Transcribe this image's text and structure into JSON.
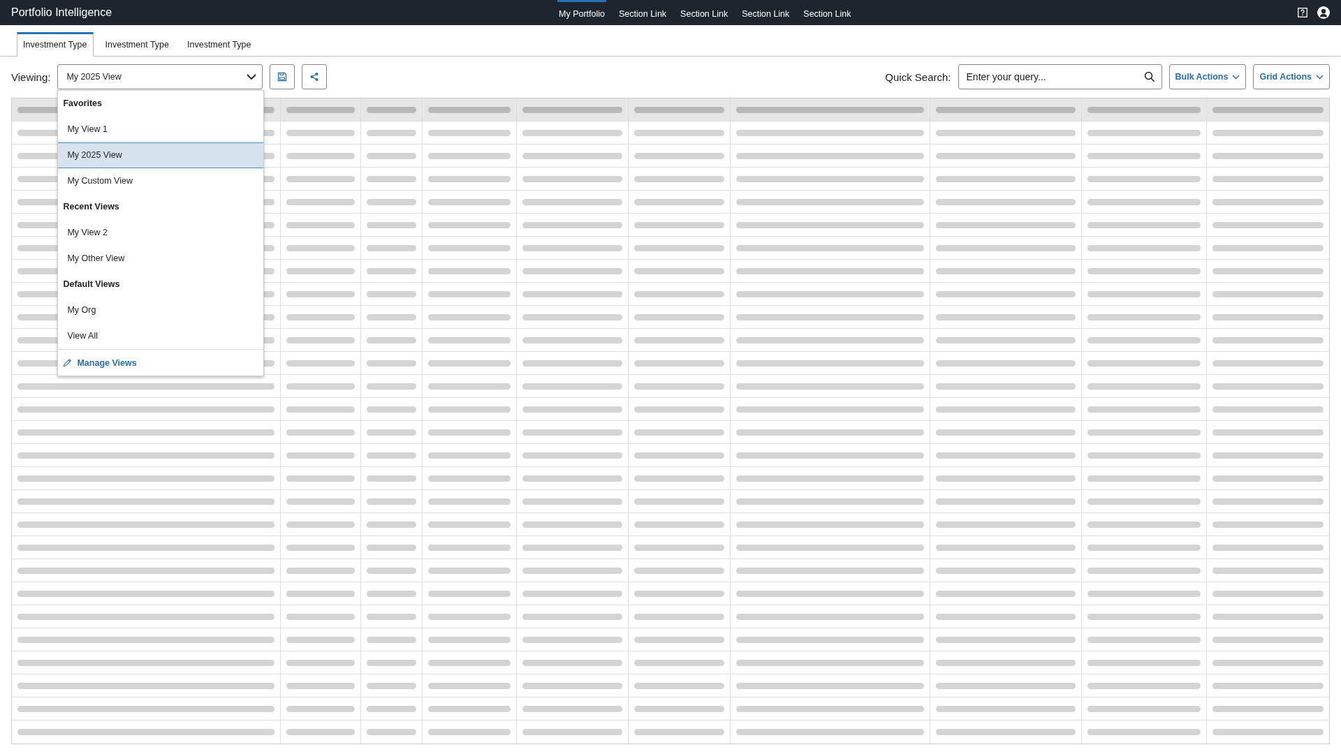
{
  "app_title": "Portfolio Intelligence",
  "nav_links": [
    {
      "label": "My Portfolio",
      "selected": true
    },
    {
      "label": "Section Link",
      "selected": false
    },
    {
      "label": "Section Link",
      "selected": false
    },
    {
      "label": "Section Link",
      "selected": false
    },
    {
      "label": "Section Link",
      "selected": false
    }
  ],
  "tabs": [
    {
      "label": "Investment Type",
      "selected": true
    },
    {
      "label": "Investment Type",
      "selected": false
    },
    {
      "label": "Investment Type",
      "selected": false
    }
  ],
  "toolbar": {
    "viewing_label": "Viewing:",
    "view_select": {
      "value": "My 2025 View"
    },
    "quick_search_label": "Quick Search:",
    "search": {
      "placeholder": "Enter your query..."
    },
    "bulk_actions": "Bulk Actions",
    "grid_actions": "Grid Actions"
  },
  "view_menu": {
    "groups": [
      {
        "heading": "Favorites",
        "items": [
          {
            "label": "My View 1",
            "selected": false
          },
          {
            "label": "My 2025 View",
            "selected": true
          },
          {
            "label": "My Custom View",
            "selected": false
          }
        ]
      },
      {
        "heading": "Recent Views",
        "items": [
          {
            "label": "My View 2",
            "selected": false
          },
          {
            "label": "My Other View",
            "selected": false
          }
        ]
      },
      {
        "heading": "Default Views",
        "items": [
          {
            "label": "My Org",
            "selected": false
          },
          {
            "label": "View All",
            "selected": false
          }
        ]
      }
    ],
    "manage_link": "Manage Views"
  }
}
